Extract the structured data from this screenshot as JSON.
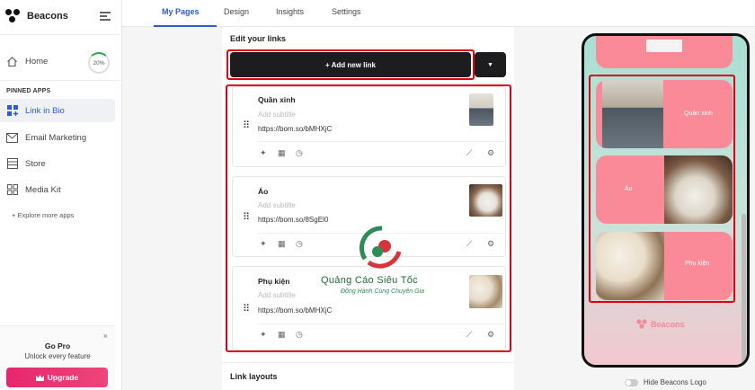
{
  "sidebar": {
    "brand": "Beacons",
    "home": "Home",
    "home_progress": "20%",
    "pinned_label": "PINNED APPS",
    "items": [
      {
        "label": "Link in Bio"
      },
      {
        "label": "Email Marketing"
      },
      {
        "label": "Store"
      },
      {
        "label": "Media Kit"
      }
    ],
    "explore": "+ Explore more apps",
    "gopro": {
      "close": "×",
      "title": "Go Pro",
      "subtitle": "Unlock every feature",
      "button": "Upgrade"
    }
  },
  "tabs": [
    "My Pages",
    "Design",
    "Insights",
    "Settings"
  ],
  "editor": {
    "section_title": "Edit your links",
    "add_button": "+ Add new link",
    "links": [
      {
        "title": "Quần xinh",
        "subtitle": "Add subtitle",
        "url": "https://bom.so/bMHXjC"
      },
      {
        "title": "Áo",
        "subtitle": "Add subtitle",
        "url": "https://bom.so/8SgEl0"
      },
      {
        "title": "Phụ kiện",
        "subtitle": "Add subtitle",
        "url": "https://bom.so/bMHXjC"
      }
    ],
    "link_layouts": "Link layouts"
  },
  "watermark": {
    "title": "Quảng Cáo Siêu Tốc",
    "subtitle": "Đồng Hành Cùng Chuyên Gia"
  },
  "preview": {
    "cards": [
      {
        "label": "Quần xinh"
      },
      {
        "label": "Áo"
      },
      {
        "label": "Phụ kiện"
      }
    ],
    "footer_brand": "Beacons",
    "hide_logo": "Hide Beacons Logo"
  },
  "colors": {
    "accent": "#2b5bd7",
    "highlight": "#e3000f",
    "upgrade": "#e8256d",
    "card_pink": "#fa8a98"
  }
}
